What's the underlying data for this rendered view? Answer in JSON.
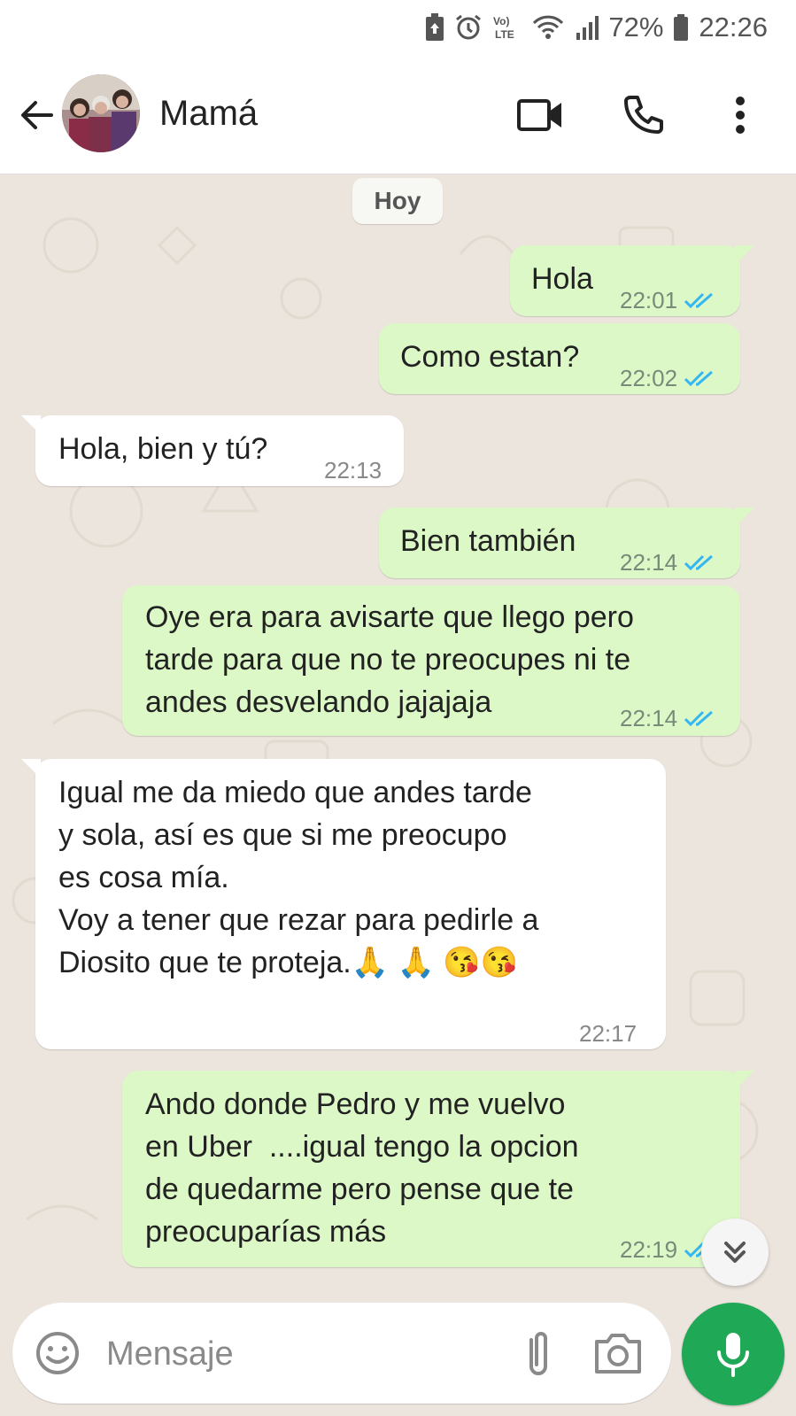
{
  "status_bar": {
    "battery_percent": "72%",
    "time": "22:26",
    "icons": [
      "battery-saver-icon",
      "alarm-icon",
      "volte-icon",
      "wifi-icon",
      "signal-icon",
      "battery-icon"
    ]
  },
  "header": {
    "back_icon": "arrow-left-icon",
    "contact_name": "Mamá",
    "video_icon": "video-call-icon",
    "call_icon": "phone-icon",
    "menu_icon": "more-vert-icon"
  },
  "chat": {
    "date_label": "Hoy",
    "messages": [
      {
        "direction": "out",
        "text": "Hola",
        "time": "22:01",
        "read": true
      },
      {
        "direction": "out",
        "text": "Como estan?",
        "time": "22:02",
        "read": true
      },
      {
        "direction": "in",
        "text": "Hola, bien y tú?",
        "time": "22:13"
      },
      {
        "direction": "out",
        "text": "Bien también",
        "time": "22:14",
        "read": true
      },
      {
        "direction": "out",
        "text": "Oye era para avisarte que llego pero\ntarde para que no te preocupes ni te\nandes desvelando jajajaja",
        "time": "22:14",
        "read": true
      },
      {
        "direction": "in",
        "text": "Igual me da miedo que andes tarde\ny sola, así es que si me preocupo\nes cosa mía.\nVoy a tener que rezar para pedirle a\nDiosito que te proteja.🙏 🙏 😘😘",
        "time": "22:17"
      },
      {
        "direction": "out",
        "text": "Ando donde Pedro y me vuelvo\nen Uber  ....igual tengo la opcion\nde quedarme pero pense que te\npreocuparías más",
        "time": "22:19",
        "read": true
      }
    ]
  },
  "composer": {
    "placeholder": "Mensaje",
    "emoji_icon": "emoji-icon",
    "attach_icon": "paperclip-icon",
    "camera_icon": "camera-icon",
    "mic_icon": "microphone-icon"
  },
  "colors": {
    "outgoing_bubble": "#dcf8c6",
    "incoming_bubble": "#ffffff",
    "chat_background": "#ece5dd",
    "read_ticks": "#34b7f1",
    "mic_button": "#1fa855"
  }
}
